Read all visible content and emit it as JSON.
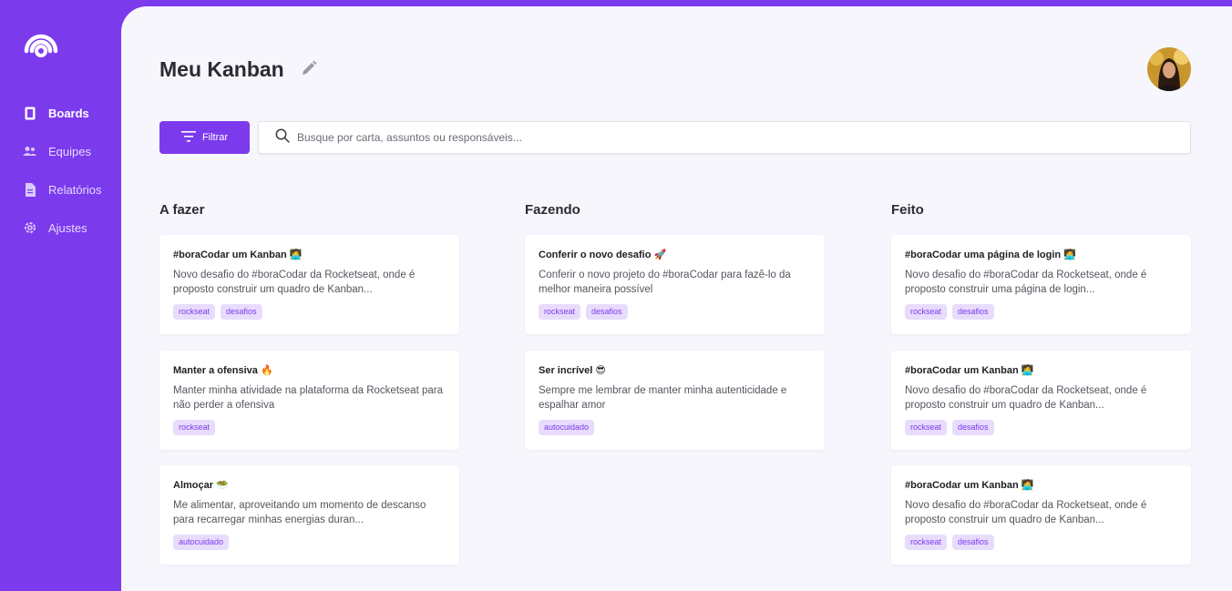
{
  "sidebar": {
    "items": [
      {
        "label": "Boards",
        "icon": "board-icon",
        "active": true
      },
      {
        "label": "Equipes",
        "icon": "team-icon",
        "active": false
      },
      {
        "label": "Relatórios",
        "icon": "report-icon",
        "active": false
      },
      {
        "label": "Ajustes",
        "icon": "gear-icon",
        "active": false
      }
    ]
  },
  "header": {
    "title": "Meu Kanban"
  },
  "toolbar": {
    "filter_label": "Filtrar",
    "search_placeholder": "Busque por carta, assuntos ou responsáveis..."
  },
  "columns": [
    {
      "title": "A fazer",
      "cards": [
        {
          "title": "#boraCodar um Kanban 🧑‍💻",
          "desc": "Novo desafio do #boraCodar da Rocketseat, onde é proposto construir um quadro de Kanban...",
          "tags": [
            "rockseat",
            "desafios"
          ]
        },
        {
          "title": "Manter a ofensiva 🔥",
          "desc": "Manter minha atividade na plataforma da Rocketseat para não perder a ofensiva",
          "tags": [
            "rockseat"
          ]
        },
        {
          "title": "Almoçar 🥗",
          "desc": "Me alimentar, aproveitando um momento de descanso para recarregar minhas energias duran...",
          "tags": [
            "autocuidado"
          ]
        }
      ]
    },
    {
      "title": "Fazendo",
      "cards": [
        {
          "title": "Conferir o novo desafio 🚀",
          "desc": "Conferir o novo projeto do #boraCodar para fazê-lo da melhor maneira possível",
          "tags": [
            "rockseat",
            "desafios"
          ]
        },
        {
          "title": "Ser incrível 😎",
          "desc": "Sempre me lembrar de manter minha autenticidade e espalhar amor",
          "tags": [
            "autocuidado"
          ]
        }
      ]
    },
    {
      "title": "Feito",
      "cards": [
        {
          "title": "#boraCodar uma página de login 🧑‍💻",
          "desc": "Novo desafio do #boraCodar da Rocketseat, onde é proposto construir uma página de login...",
          "tags": [
            "rockseat",
            "desafios"
          ]
        },
        {
          "title": "#boraCodar um Kanban 🧑‍💻",
          "desc": "Novo desafio do #boraCodar da Rocketseat, onde é proposto construir um quadro de Kanban...",
          "tags": [
            "rockseat",
            "desafios"
          ]
        },
        {
          "title": "#boraCodar um Kanban 🧑‍💻",
          "desc": "Novo desafio do #boraCodar da Rocketseat, onde é proposto construir um quadro de Kanban...",
          "tags": [
            "rockseat",
            "desafios"
          ]
        }
      ]
    }
  ],
  "colors": {
    "accent": "#7c3aed",
    "background": "#f6f6fc",
    "tag_bg": "#e8dcfd"
  }
}
